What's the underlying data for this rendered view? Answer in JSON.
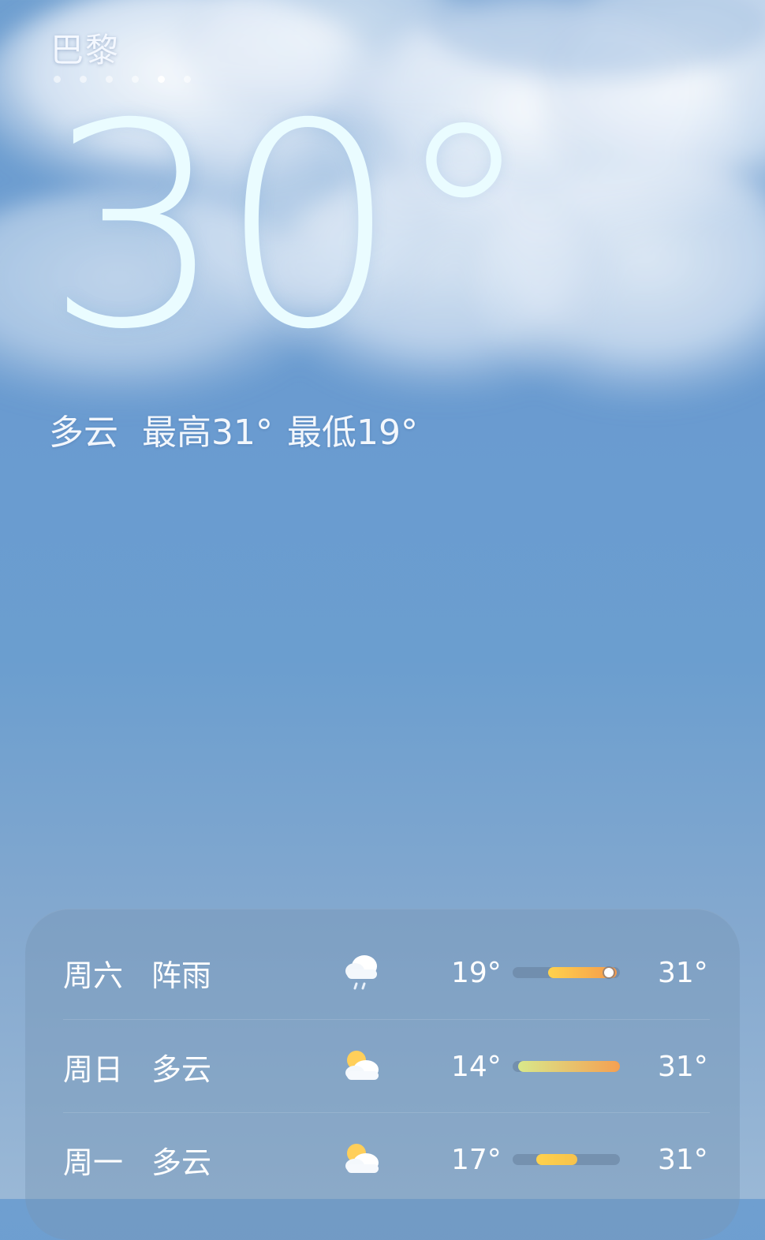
{
  "city": "巴黎",
  "page_dots": [
    false,
    false,
    false,
    false,
    true,
    false
  ],
  "current": {
    "temp": "30°",
    "condition": "多云",
    "high": "最高31°",
    "low": "最低19°"
  },
  "forecast": [
    {
      "day": "周六",
      "condition": "阵雨",
      "icon": "shower-cloud-icon",
      "low": "19°",
      "high": "31°",
      "range_start": 0.33,
      "range_end": 0.97,
      "current_marker": 0.9,
      "fill_colors": [
        "#ffd24d",
        "#f59a4c"
      ]
    },
    {
      "day": "周日",
      "condition": "多云",
      "icon": "partly-cloudy-icon",
      "low": "14°",
      "high": "31°",
      "range_start": 0.05,
      "range_end": 1.0,
      "current_marker": null,
      "fill_colors": [
        "#d9e88a",
        "#f5a052"
      ]
    },
    {
      "day": "周一",
      "condition": "多云",
      "icon": "partly-cloudy-icon",
      "low": "17°",
      "high": "31°",
      "range_start": 0.22,
      "range_end": 0.6,
      "current_marker": null,
      "fill_colors": [
        "#ffd24d",
        "#f6c24c"
      ]
    }
  ]
}
